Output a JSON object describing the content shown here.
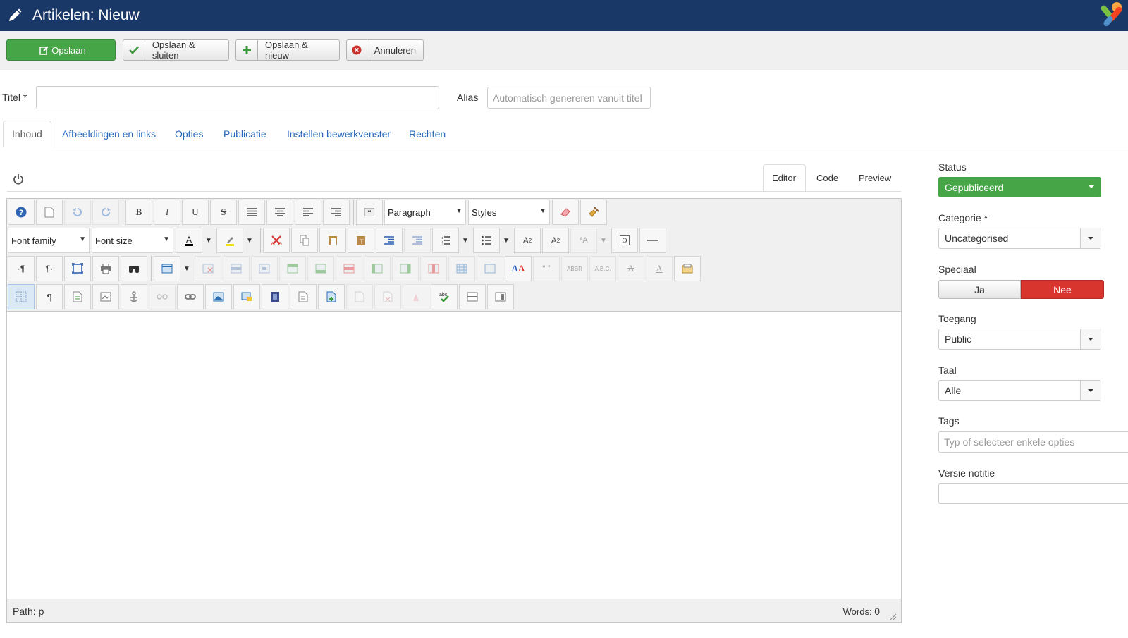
{
  "header": {
    "title": "Artikelen: Nieuw"
  },
  "toolbar": {
    "save": "Opslaan",
    "save_close": "Opslaan & sluiten",
    "save_new": "Opslaan & nieuw",
    "cancel": "Annuleren"
  },
  "form": {
    "title_label": "Titel *",
    "title_value": "",
    "alias_label": "Alias",
    "alias_placeholder": "Automatisch genereren vanuit titel"
  },
  "tabs": [
    "Inhoud",
    "Afbeeldingen en links",
    "Opties",
    "Publicatie",
    "Instellen bewerkvenster",
    "Rechten"
  ],
  "editor": {
    "modes": [
      "Editor",
      "Code",
      "Preview"
    ],
    "format_select": "Paragraph",
    "styles_select": "Styles",
    "font_family": "Font family",
    "font_size": "Font size",
    "path_label": "Path:",
    "path_value": "p",
    "words_label": "Words:",
    "words_value": "0"
  },
  "sidebar": {
    "status_label": "Status",
    "status_value": "Gepubliceerd",
    "category_label": "Categorie *",
    "category_value": "Uncategorised",
    "featured_label": "Speciaal",
    "featured_yes": "Ja",
    "featured_no": "Nee",
    "access_label": "Toegang",
    "access_value": "Public",
    "language_label": "Taal",
    "language_value": "Alle",
    "tags_label": "Tags",
    "tags_placeholder": "Typ of selecteer enkele opties",
    "version_label": "Versie notitie",
    "version_value": ""
  },
  "colors": {
    "header_bg": "#1a3867",
    "save_green": "#46a546",
    "status_green": "#46a546",
    "no_red": "#d9352f",
    "link_blue": "#2a69b8"
  }
}
